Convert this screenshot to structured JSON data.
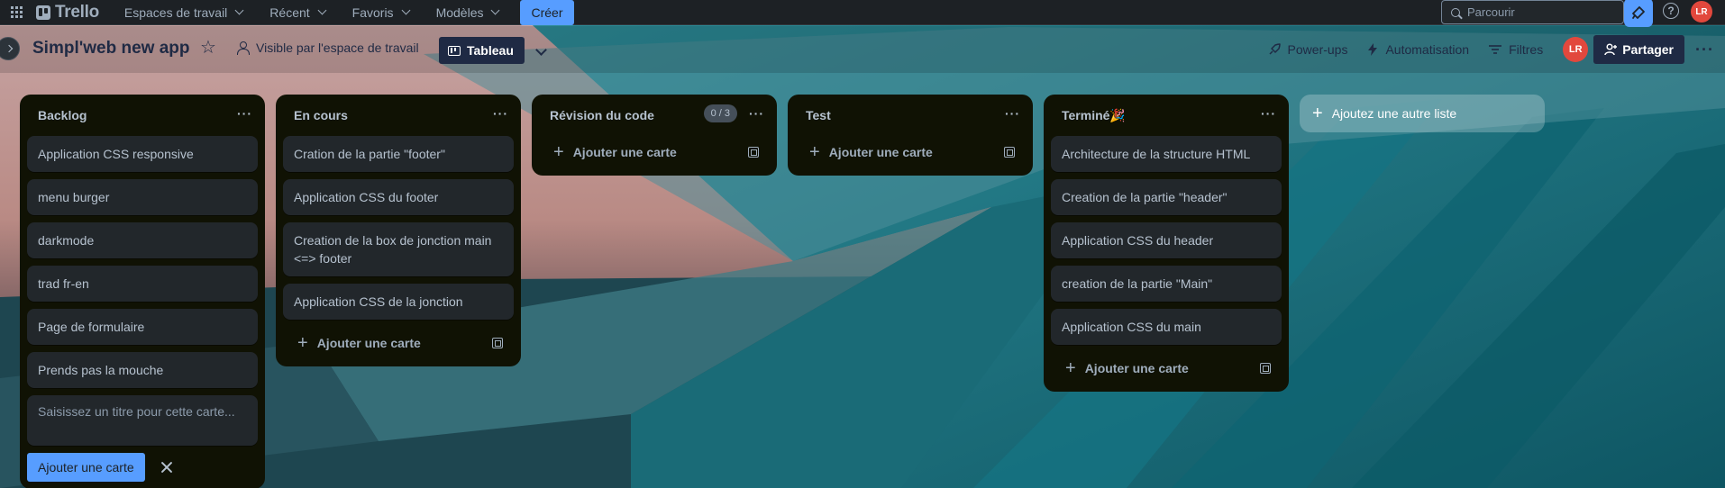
{
  "topnav": {
    "logo": "Trello",
    "menus": [
      "Espaces de travail",
      "Récent",
      "Favoris",
      "Modèles"
    ],
    "create_label": "Créer",
    "search_placeholder": "Parcourir",
    "help": "?",
    "avatar": "LR",
    "icons": [
      "apps-grid-icon",
      "trello-logo-icon",
      "search-icon",
      "megaphone-icon",
      "help-icon"
    ]
  },
  "board": {
    "title": "Simpl'web new app",
    "star": "☆",
    "visibility": "Visible par l'espace de travail",
    "view": "Tableau",
    "powerups": "Power-ups",
    "automation": "Automatisation",
    "filters": "Filtres",
    "avatar": "LR",
    "share": "Partager",
    "more": "···"
  },
  "lists": {
    "backlog": {
      "title": "Backlog",
      "cards": [
        "Application CSS responsive",
        "menu burger",
        "darkmode",
        "trad fr-en",
        "Page de formulaire",
        "Prends pas la mouche"
      ],
      "composer_placeholder": "Saisissez un titre pour cette carte...",
      "add_button": "Ajouter une carte"
    },
    "encours": {
      "title": "En cours",
      "cards": [
        "Cration de la partie \"footer\"",
        "Application CSS du footer",
        "Creation de la box de jonction main <=> footer",
        "Application CSS de la jonction"
      ],
      "add_card": "Ajouter une carte"
    },
    "revision": {
      "title": "Révision du code",
      "badge": "0 / 3",
      "add_card": "Ajouter une carte"
    },
    "test": {
      "title": "Test",
      "add_card": "Ajouter une carte"
    },
    "termine": {
      "title": "Terminé🎉",
      "cards": [
        "Architecture de la structure HTML",
        "Creation de la partie \"header\"",
        "Application CSS du header",
        "creation de la partie \"Main\"",
        "Application CSS du main"
      ],
      "add_card": "Ajouter une carte"
    }
  },
  "add_list": "Ajoutez une autre liste",
  "colors": {
    "accent": "#579dff",
    "list_bg": "#101204",
    "card_bg": "#22272b",
    "avatar": "#e2483d",
    "nav_bg": "#1d2125"
  }
}
